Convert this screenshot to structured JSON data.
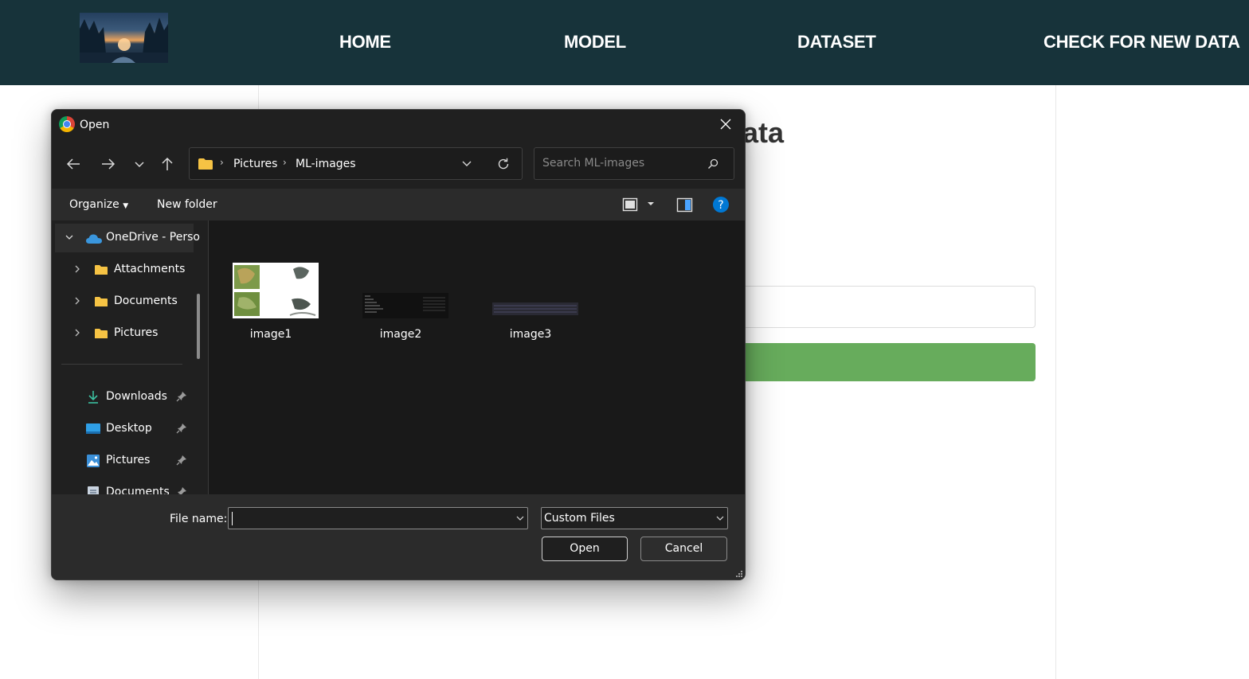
{
  "site": {
    "nav": [
      "HOME",
      "MODEL",
      "DATASET",
      "CHECK FOR NEW DATA"
    ],
    "heading_visible": "ata"
  },
  "dialog": {
    "title": "Open",
    "breadcrumb": [
      "Pictures",
      "ML-images"
    ],
    "search_placeholder": "Search ML-images",
    "toolbar": {
      "organize": "Organize",
      "new_folder": "New folder"
    },
    "sidebar": {
      "tree": [
        {
          "label": "OneDrive - Perso",
          "icon": "onedrive-cloud-icon",
          "expanded": true,
          "selected": true
        },
        {
          "label": "Attachments",
          "icon": "folder-icon"
        },
        {
          "label": "Documents",
          "icon": "folder-icon"
        },
        {
          "label": "Pictures",
          "icon": "folder-icon"
        }
      ],
      "quick_access": [
        {
          "label": "Downloads",
          "icon": "download-arrow-icon",
          "pinned": true
        },
        {
          "label": "Desktop",
          "icon": "desktop-icon",
          "pinned": true
        },
        {
          "label": "Pictures",
          "icon": "pictures-icon",
          "pinned": true
        },
        {
          "label": "Documents",
          "icon": "documents-icon",
          "pinned": true
        }
      ]
    },
    "files": [
      {
        "name": "image1"
      },
      {
        "name": "image2"
      },
      {
        "name": "image3"
      }
    ],
    "file_name_label": "File name:",
    "file_name_value": "",
    "file_type": "Custom Files",
    "open_button": "Open",
    "cancel_button": "Cancel"
  },
  "colors": {
    "topbar": "#17333a",
    "page_button": "#67ac5c",
    "dialog_bg": "#202020",
    "file_area": "#191919",
    "help_blue": "#0078d4",
    "folder_yellow": "#f6c344"
  }
}
